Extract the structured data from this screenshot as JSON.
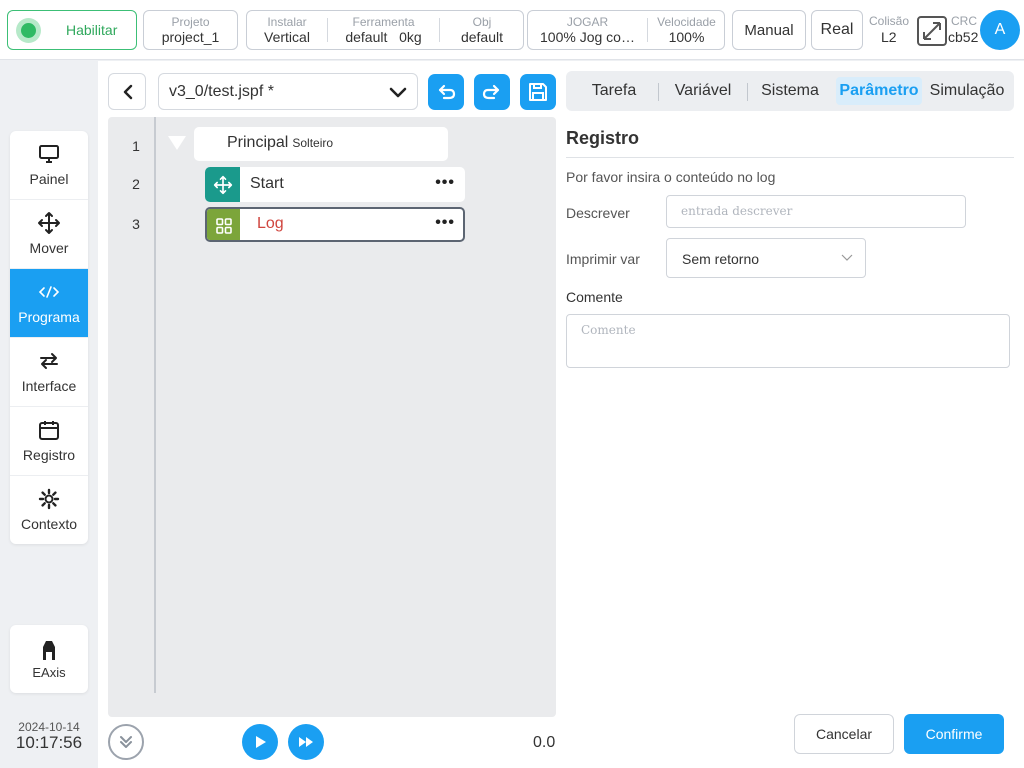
{
  "topbar": {
    "enable_label": "Habilitar",
    "project": {
      "label": "Projeto",
      "value": "project_1"
    },
    "install": {
      "label": "Instalar",
      "value": "Vertical"
    },
    "tool": {
      "label": "Ferramenta",
      "value": "default",
      "extra": "0kg"
    },
    "obj": {
      "label": "Obj",
      "value": "default"
    },
    "jog": {
      "label": "JOGAR",
      "value": "100%  Jog co…"
    },
    "speed": {
      "label": "Velocidade",
      "value": "100%"
    },
    "manual_label": "Manual",
    "real_label": "Real",
    "collision": {
      "label": "Colisão",
      "value": "L2"
    },
    "crc": {
      "label": "CRC",
      "value": "cb52"
    },
    "avatar_letter": "A",
    "colors": {
      "accent": "#1a9ff2",
      "enable": "#2fba64"
    }
  },
  "nav": {
    "items": [
      {
        "label": "Painel",
        "icon": "monitor-icon"
      },
      {
        "label": "Mover",
        "icon": "move-arrows-icon"
      },
      {
        "label": "Programa",
        "icon": "code-icon"
      },
      {
        "label": "Interface",
        "icon": "swap-icon"
      },
      {
        "label": "Registro",
        "icon": "calendar-icon"
      },
      {
        "label": "Contexto",
        "icon": "gear-icon"
      }
    ],
    "active": "Programa",
    "eaxis_label": "EAxis"
  },
  "clock": {
    "date": "2024-10-14",
    "time": "10:17:56"
  },
  "program": {
    "file_name": "v3_0/test.jspf *",
    "lines": [
      "1",
      "2",
      "3"
    ],
    "main_node": {
      "label": "Principal",
      "sublabel": "Solteiro"
    },
    "nodes": [
      {
        "label": "Start",
        "color": "#1a9a8c",
        "icon": "move-arrows-icon"
      },
      {
        "label": "Log",
        "color": "#7ca53a",
        "icon": "grid-icon"
      }
    ],
    "value": "0.0"
  },
  "tabs": [
    "Tarefa",
    "Variável",
    "Sistema",
    "Parâmetro",
    "Simulação"
  ],
  "active_tab": "Parâmetro",
  "form": {
    "title": "Registro",
    "hint": "Por favor insira o conteúdo no log",
    "describe_label": "Descrever",
    "describe_placeholder": "entrada descrever",
    "print_var_label": "Imprimir var",
    "print_var_value": "Sem retorno",
    "comment_label": "Comente",
    "comment_placeholder": "Comente",
    "cancel_label": "Cancelar",
    "confirm_label": "Confirme"
  }
}
